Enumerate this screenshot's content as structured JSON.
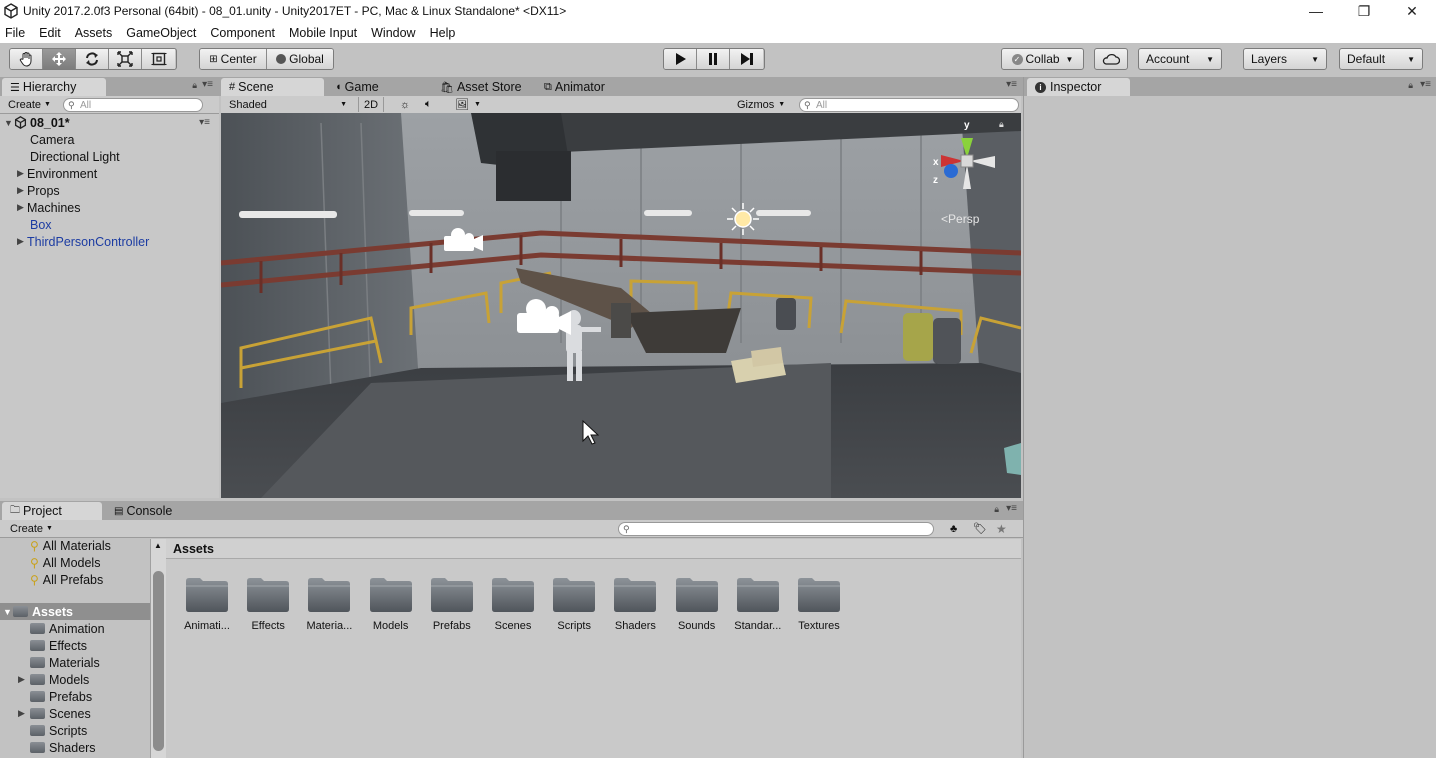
{
  "window": {
    "title": "Unity 2017.2.0f3 Personal (64bit) - 08_01.unity - Unity2017ET - PC, Mac & Linux Standalone* <DX11>",
    "minimize": "—",
    "restore": "❐",
    "close": "✕"
  },
  "menu": [
    "File",
    "Edit",
    "Assets",
    "GameObject",
    "Component",
    "Mobile Input",
    "Window",
    "Help"
  ],
  "toolbar": {
    "tools": [
      "hand-tool",
      "move-tool",
      "rotate-tool",
      "scale-tool",
      "rect-tool"
    ],
    "pivot_mode": "Center",
    "pivot_space": "Global",
    "collab": "Collab",
    "account": "Account",
    "layers": "Layers",
    "layout": "Default"
  },
  "hierarchy": {
    "tab": "Hierarchy",
    "create": "Create",
    "search_placeholder": "All",
    "scene_name": "08_01*",
    "items": [
      {
        "label": "Camera",
        "expandable": false,
        "color": "black"
      },
      {
        "label": "Directional Light",
        "expandable": false,
        "color": "black"
      },
      {
        "label": "Environment",
        "expandable": true,
        "color": "black"
      },
      {
        "label": "Props",
        "expandable": true,
        "color": "black"
      },
      {
        "label": "Machines",
        "expandable": true,
        "color": "black"
      },
      {
        "label": "Box",
        "expandable": false,
        "color": "blue"
      },
      {
        "label": "ThirdPersonController",
        "expandable": true,
        "color": "blue"
      }
    ]
  },
  "scene_view": {
    "tabs": [
      "Scene",
      "Game",
      "Asset Store",
      "Animator"
    ],
    "shading": "Shaded",
    "mode_2d": "2D",
    "gizmos": "Gizmos",
    "search_placeholder": "All",
    "projection": "Persp",
    "axis_labels": {
      "x": "x",
      "y": "y",
      "z": "z"
    }
  },
  "inspector": {
    "tab": "Inspector"
  },
  "project": {
    "tabs": [
      "Project",
      "Console"
    ],
    "create": "Create",
    "favorites": [
      "All Materials",
      "All Models",
      "All Prefabs"
    ],
    "root": "Assets",
    "tree": [
      {
        "label": "Animation",
        "expandable": false
      },
      {
        "label": "Effects",
        "expandable": false
      },
      {
        "label": "Materials",
        "expandable": false
      },
      {
        "label": "Models",
        "expandable": true
      },
      {
        "label": "Prefabs",
        "expandable": false
      },
      {
        "label": "Scenes",
        "expandable": true
      },
      {
        "label": "Scripts",
        "expandable": false
      },
      {
        "label": "Shaders",
        "expandable": false
      }
    ],
    "breadcrumb": "Assets",
    "folders": [
      "Animati...",
      "Effects",
      "Materia...",
      "Models",
      "Prefabs",
      "Scenes",
      "Scripts",
      "Shaders",
      "Sounds",
      "Standar...",
      "Textures"
    ]
  },
  "colors": {
    "panel_bg": "#c2c2c2",
    "tab_bar": "#a5a5a5",
    "selected_blue": "#1c3ca2",
    "scene_wall": "#8a8f94",
    "railing_red": "#7a3b31",
    "railing_yellow": "#c8a236"
  }
}
